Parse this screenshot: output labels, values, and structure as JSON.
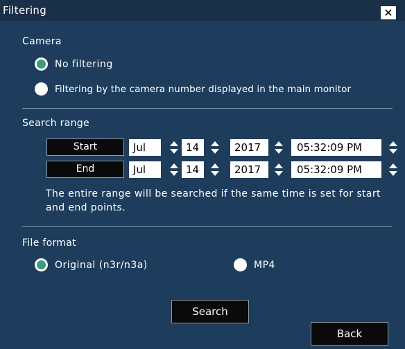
{
  "dialog": {
    "title": "Filtering",
    "close_glyph": "✕"
  },
  "camera": {
    "label": "Camera",
    "options": [
      {
        "label": "No filtering",
        "selected": true
      },
      {
        "label": "Filtering by the camera number displayed in the main monitor",
        "selected": false
      }
    ]
  },
  "search_range": {
    "label": "Search range",
    "start": {
      "label": "Start",
      "month": "Jul",
      "day": "14",
      "year": "2017",
      "time": "05:32:09 PM"
    },
    "end": {
      "label": "End",
      "month": "Jul",
      "day": "14",
      "year": "2017",
      "time": "05:32:09 PM"
    },
    "note": "The entire range will be searched if the same time is set for start and end points."
  },
  "file_format": {
    "label": "File format",
    "options": [
      {
        "label": "Original (n3r/n3a)",
        "selected": true
      },
      {
        "label": "MP4",
        "selected": false
      }
    ]
  },
  "buttons": {
    "search": "Search",
    "back": "Back"
  },
  "colors": {
    "background": "#1e3d5c",
    "titlebar": "#1a2f48",
    "radio_selected": "#3c9a80",
    "button": "#0a0a0a"
  }
}
